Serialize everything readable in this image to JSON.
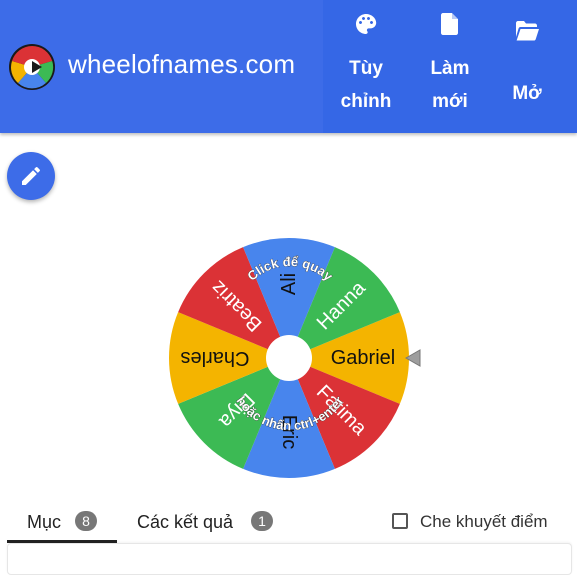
{
  "header": {
    "site_title": "wheelofnames.com",
    "accent_color": "#3d6ce8",
    "nav": [
      {
        "line1": "Tùy",
        "line2": "chỉnh",
        "icon": "palette-icon"
      },
      {
        "line1": "Làm",
        "line2": "mới",
        "icon": "file-icon"
      },
      {
        "line1": "Mở",
        "icon": "folder-open-icon"
      }
    ]
  },
  "toolbar": {
    "edit_icon": "pencil-icon"
  },
  "wheel": {
    "entries": [
      "Gabriel",
      "Fatima",
      "Eric",
      "Diya",
      "Charles",
      "Beatriz",
      "Ali",
      "Hanna"
    ],
    "colors": [
      "#f4b400",
      "#db3236",
      "#4885ed",
      "#3cba54",
      "#f4b400",
      "#db3236",
      "#4885ed",
      "#3cba54"
    ],
    "spin_hint_top": "Click để quay",
    "spin_hint_bottom": "hoặc nhấn ctrl+enter",
    "pointer": "pointer-arrow-icon"
  },
  "tabs": [
    {
      "label": "Mục",
      "count": "8"
    },
    {
      "label": "Các kết quả",
      "count": "1"
    }
  ],
  "options": {
    "hide_label": "Che khuyết điểm",
    "hide_checked": false
  }
}
